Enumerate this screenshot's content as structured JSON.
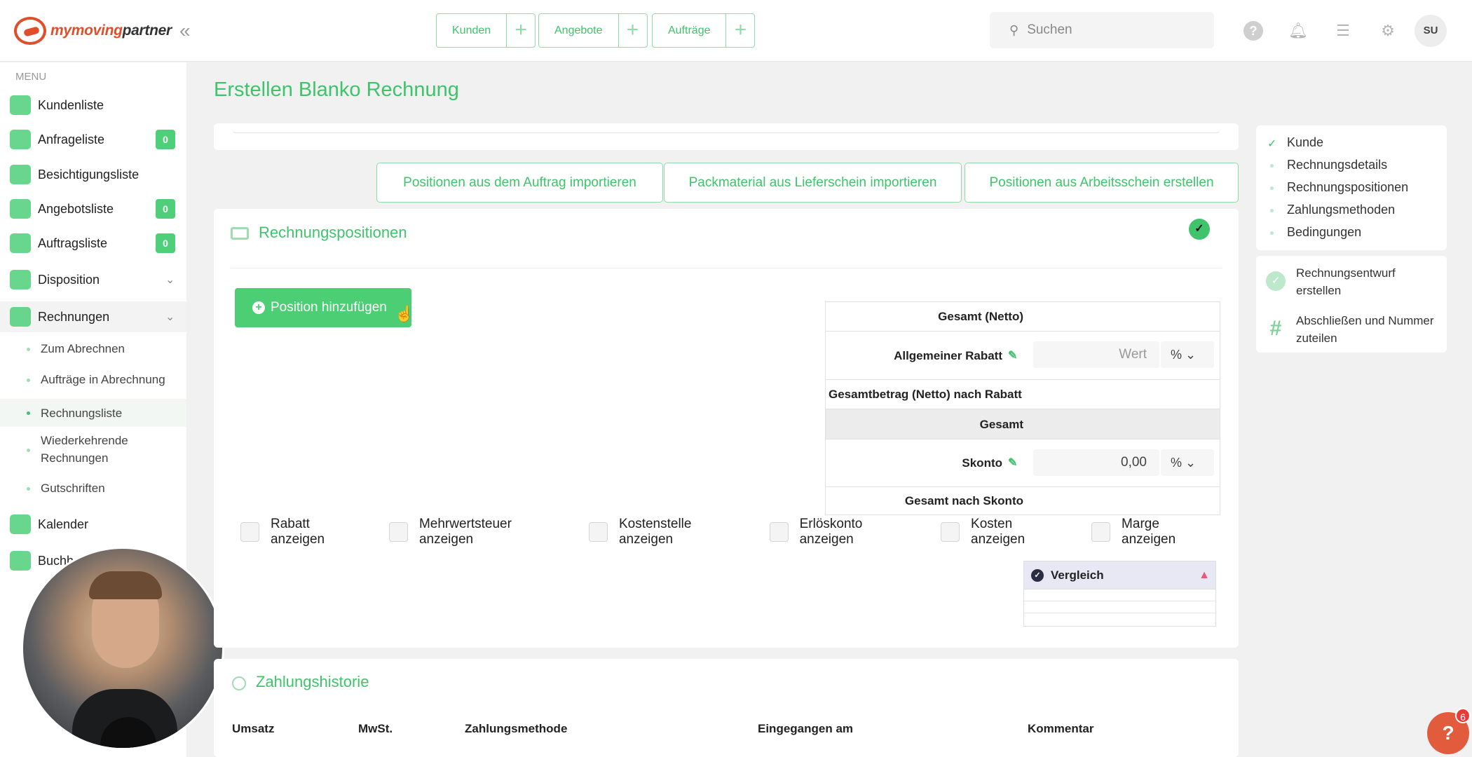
{
  "brand": {
    "name_part1": "my",
    "name_part2": "moving",
    "name_part3": "partner"
  },
  "topbar": {
    "quick_links": [
      {
        "label": "Kunden"
      },
      {
        "label": "Angebote"
      },
      {
        "label": "Aufträge"
      }
    ],
    "search_placeholder": "Suchen",
    "avatar_initials": "SU"
  },
  "sidebar": {
    "menu_label": "MENU",
    "items": [
      {
        "label": "Kundenliste"
      },
      {
        "label": "Anfrageliste",
        "badge": "0"
      },
      {
        "label": "Besichtigungsliste"
      },
      {
        "label": "Angebotsliste",
        "badge": "0"
      },
      {
        "label": "Auftragsliste",
        "badge": "0"
      },
      {
        "label": "Disposition"
      },
      {
        "label": "Rechnungen"
      },
      {
        "label": "Kalender"
      },
      {
        "label": "Buchh"
      }
    ],
    "sub_items": [
      {
        "label": "Zum Abrechnen"
      },
      {
        "label": "Aufträge in Abrechnung"
      },
      {
        "label": "Rechnungsliste"
      },
      {
        "label": "Wiederkehrende Rechnungen"
      },
      {
        "label": "Gutschriften"
      }
    ]
  },
  "page": {
    "title": "Erstellen Blanko Rechnung",
    "import_buttons": [
      {
        "label": "Positionen aus dem Auftrag importieren"
      },
      {
        "label": "Packmaterial aus Lieferschein importieren"
      },
      {
        "label": "Positionen aus Arbeitsschein erstellen"
      }
    ],
    "positions": {
      "title": "Rechnungspositionen",
      "add_button": "Position hinzufügen",
      "totals": {
        "net_total": "Gesamt (Netto)",
        "discount_label": "Allgemeiner Rabatt",
        "discount_placeholder": "Wert",
        "discount_unit": "%",
        "net_after_discount": "Gesamtbetrag (Netto) nach Rabatt",
        "total": "Gesamt",
        "skonto_label": "Skonto",
        "skonto_value": "0,00",
        "skonto_unit": "%",
        "total_after_skonto": "Gesamt nach Skonto"
      },
      "checkboxes": [
        {
          "label": "Rabatt anzeigen"
        },
        {
          "label": "Mehrwertsteuer anzeigen"
        },
        {
          "label": "Kostenstelle anzeigen"
        },
        {
          "label": "Erlöskonto anzeigen"
        },
        {
          "label": "Kosten anzeigen"
        },
        {
          "label": "Marge anzeigen"
        }
      ],
      "comparison_label": "Vergleich"
    },
    "history": {
      "title": "Zahlungshistorie",
      "columns": [
        "Umsatz",
        "MwSt.",
        "Zahlungsmethode",
        "Eingegangen am",
        "Kommentar"
      ]
    }
  },
  "steps": [
    {
      "label": "Kunde",
      "done": true
    },
    {
      "label": "Rechnungsdetails"
    },
    {
      "label": "Rechnungspositionen"
    },
    {
      "label": "Zahlungsmethoden"
    },
    {
      "label": "Bedingungen"
    }
  ],
  "actions": [
    {
      "label": "Rechnungsentwurf erstellen"
    },
    {
      "label": "Abschließen und Nummer zuteilen"
    }
  ],
  "help": {
    "label": "?",
    "badge": "6"
  },
  "colors": {
    "accent": "#3fc36b",
    "brand": "#e04e2b"
  }
}
